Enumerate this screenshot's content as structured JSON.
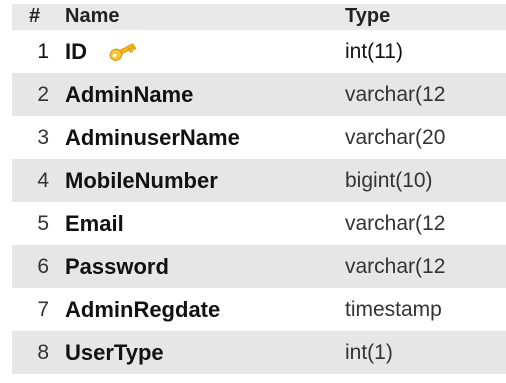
{
  "table": {
    "headers": {
      "num": "#",
      "name": "Name",
      "type": "Type"
    },
    "rows": [
      {
        "num": "1",
        "name": "ID",
        "type": "int(11)",
        "primary_key_icon": "key-icon"
      },
      {
        "num": "2",
        "name": "AdminName",
        "type": "varchar(12"
      },
      {
        "num": "3",
        "name": "AdminuserName",
        "type": "varchar(20"
      },
      {
        "num": "4",
        "name": "MobileNumber",
        "type": "bigint(10)"
      },
      {
        "num": "5",
        "name": "Email",
        "type": "varchar(12"
      },
      {
        "num": "6",
        "name": "Password",
        "type": "varchar(12"
      },
      {
        "num": "7",
        "name": "AdminRegdate",
        "type": "timestamp"
      },
      {
        "num": "8",
        "name": "UserType",
        "type": "int(1)"
      }
    ]
  },
  "colors": {
    "header_bg": "#e9e9e9",
    "row_even_bg": "#e6e6e6",
    "row_odd_bg": "#ffffff",
    "key_icon": "#f2b51a"
  }
}
